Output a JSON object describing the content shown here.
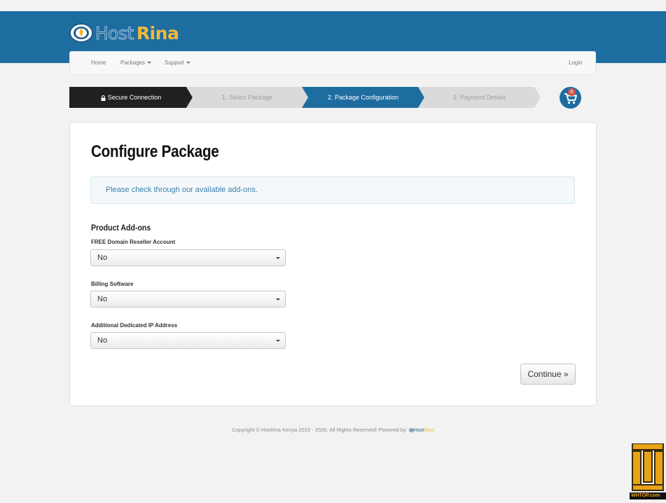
{
  "brand": {
    "host": "Host",
    "rina": "Rina"
  },
  "nav": {
    "home": "Home",
    "packages": "Packages",
    "support": "Support",
    "login": "Login"
  },
  "steps": {
    "secure": "Secure Connection",
    "select": "1. Select Package",
    "config": "2. Package Configuration",
    "payment": "3. Payment Details"
  },
  "cart": {
    "count": "0",
    "icon": "shopping-cart-icon"
  },
  "page": {
    "title": "Configure Package",
    "info": "Please check through our available add-ons."
  },
  "addons": {
    "title": "Product Add-ons",
    "items": [
      {
        "label": "FREE Domain Reseller Account",
        "value": "No"
      },
      {
        "label": "Billing Software",
        "value": "No"
      },
      {
        "label": "Additional Dedicated IP Address",
        "value": "No"
      }
    ]
  },
  "continue_label": "Continue »",
  "footer": {
    "copyright": "Copyright © Hostrina Kenya 2015 - 2020. All Rights Reserved! Powered by",
    "logo_host": "Host",
    "logo_rina": "Rina"
  },
  "watermark": {
    "site": "WHTOP.com"
  },
  "colors": {
    "header": "#1e6da1",
    "active_step": "#1e6da1",
    "secure_step": "#1f2022",
    "inactive_step": "#dadada",
    "badge": "#d9534f",
    "logo_gold": "#f0b93a"
  }
}
